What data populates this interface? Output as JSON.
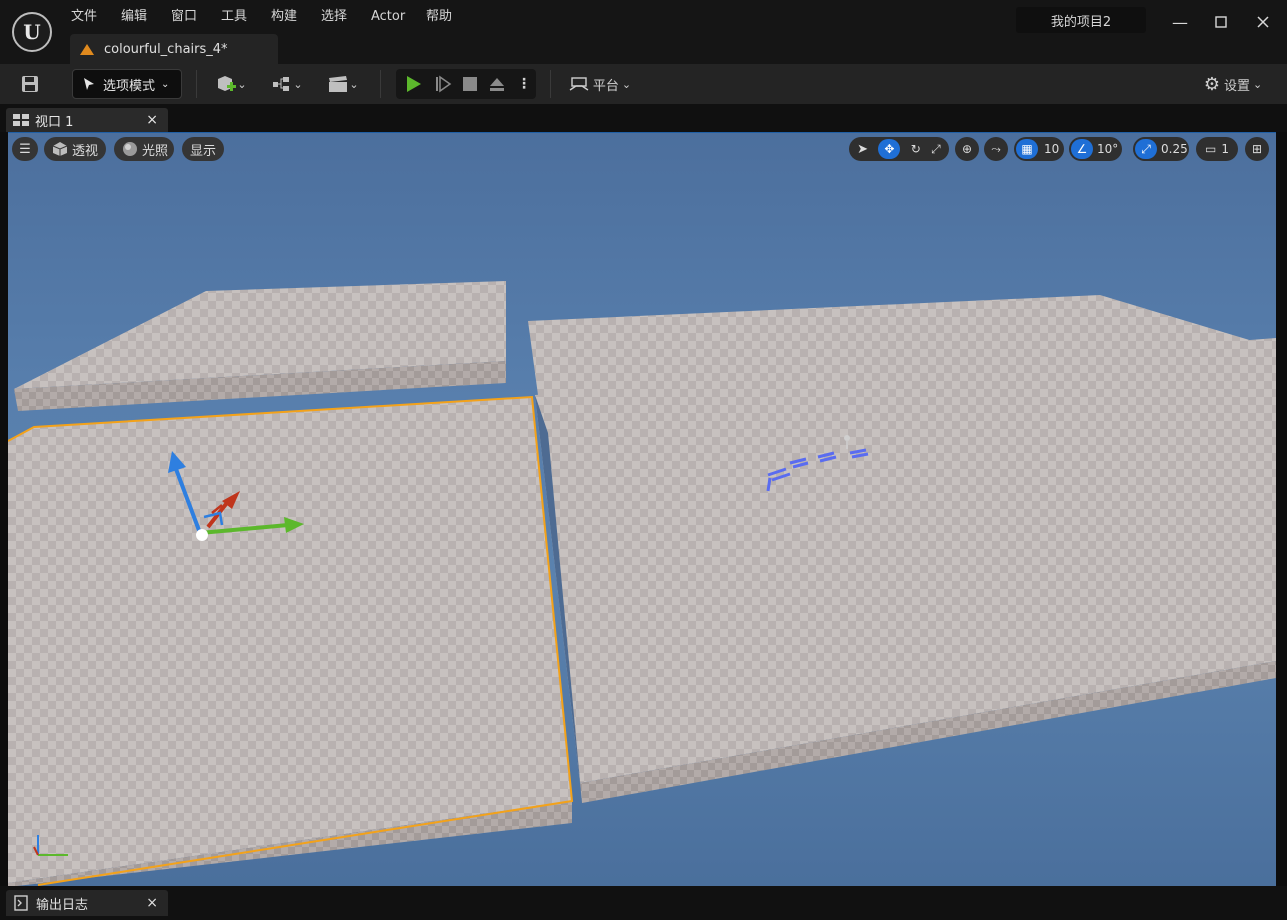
{
  "app": {
    "logo_letter": "U",
    "project_name": "我的项目2"
  },
  "menu": [
    "文件",
    "编辑",
    "窗口",
    "工具",
    "构建",
    "选择",
    "Actor",
    "帮助"
  ],
  "document_tab": {
    "title": "colourful_chairs_4*"
  },
  "toolbar": {
    "mode_label": "选项模式",
    "platform_label": "平台",
    "settings_label": "设置"
  },
  "viewport_tab": {
    "title": "视口 1"
  },
  "viewport": {
    "perspective_label": "透视",
    "lighting_label": "光照",
    "show_label": "显示",
    "grid_snap": "10",
    "rotation_snap": "10°",
    "scale_snap": "0.25",
    "camera_speed": "1"
  },
  "bottom": {
    "output_log_label": "输出日志"
  },
  "colors": {
    "accent_blue": "#1f6fd6",
    "selection_orange": "#f3a21a",
    "play_green": "#5cb82c",
    "sky": "#587fad"
  },
  "icons": [
    "save-icon",
    "add-actor-icon",
    "blueprint-icon",
    "cinematics-icon",
    "play-icon",
    "step-icon",
    "stop-icon",
    "eject-icon",
    "platform-icon",
    "gear-icon",
    "hamburger-icon",
    "cube-icon",
    "sphere-icon",
    "select-icon",
    "move-icon",
    "rotate-icon",
    "scale-icon",
    "world-icon",
    "surface-snap-icon",
    "grid-icon",
    "angle-icon",
    "scale-snap-icon",
    "camera-icon",
    "layout-icon",
    "close-icon",
    "log-icon"
  ]
}
